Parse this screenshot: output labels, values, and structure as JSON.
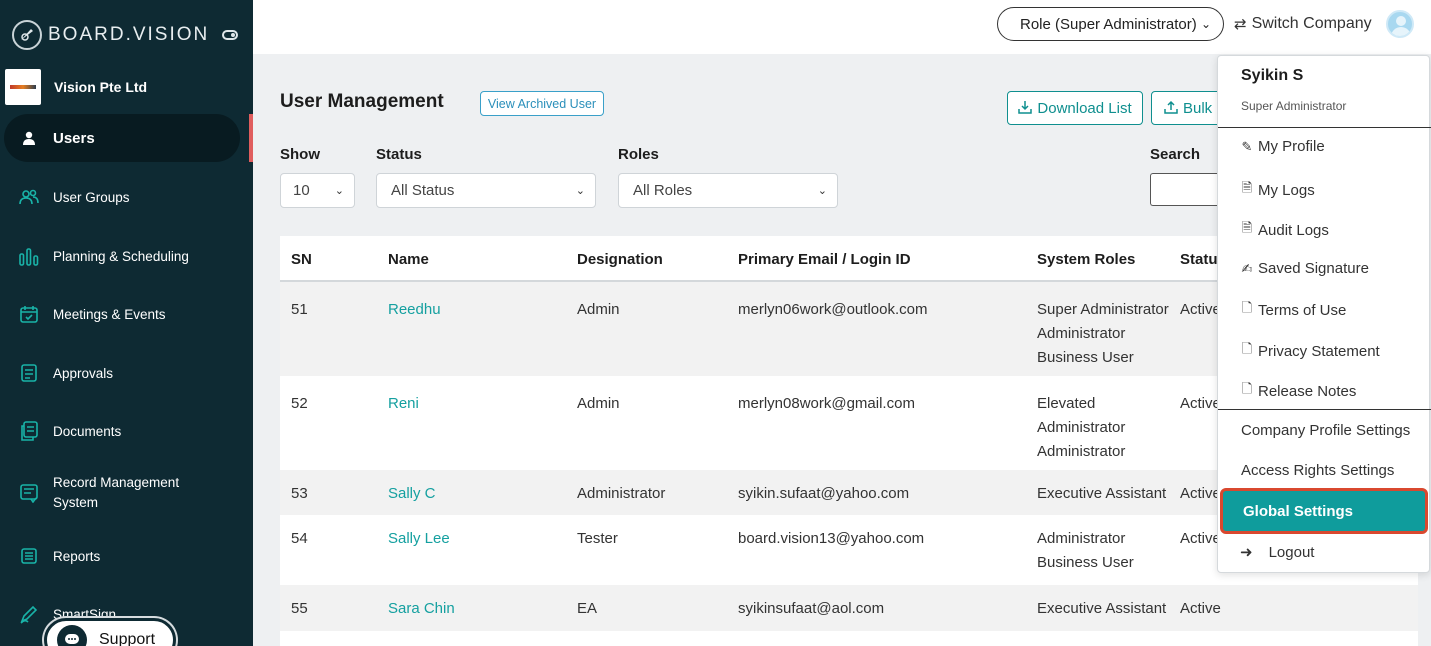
{
  "brand": {
    "name": "BOARD.VISION"
  },
  "company": {
    "name": "Vision Pte Ltd"
  },
  "sidebar": {
    "items": [
      {
        "label": "Users",
        "icon": "user-icon",
        "active": true
      },
      {
        "label": "User Groups",
        "icon": "users-icon"
      },
      {
        "label": "Planning & Scheduling",
        "icon": "bar-chart-icon"
      },
      {
        "label": "Meetings & Events",
        "icon": "calendar-icon"
      },
      {
        "label": "Approvals",
        "icon": "approval-icon"
      },
      {
        "label": "Documents",
        "icon": "documents-icon"
      },
      {
        "label": "Record Management",
        "label2": "System",
        "icon": "record-icon"
      },
      {
        "label": "Reports",
        "icon": "reports-icon"
      },
      {
        "label": "SmartSign",
        "icon": "pen-icon"
      }
    ],
    "support_label": "Support"
  },
  "topbar": {
    "role_label": "Role (Super Administrator)",
    "switch_company": "Switch Company"
  },
  "main": {
    "title": "User Management",
    "view_archived": "View Archived User",
    "download_list": "Download List",
    "bulk": "Bulk",
    "filters": {
      "show_label": "Show",
      "show_value": "10",
      "status_label": "Status",
      "status_value": "All Status",
      "roles_label": "Roles",
      "roles_value": "All Roles",
      "search_label": "Search"
    },
    "table": {
      "headers": [
        "SN",
        "Name",
        "Designation",
        "Primary Email / Login ID",
        "System Roles",
        "Status"
      ],
      "rows": [
        {
          "sn": "51",
          "name": "Reedhu",
          "designation": "Admin",
          "email": "merlyn06work@outlook.com",
          "roles": [
            "Super Administrator",
            "Administrator",
            "Business User"
          ],
          "status": "Active"
        },
        {
          "sn": "52",
          "name": "Reni",
          "designation": "Admin",
          "email": "merlyn08work@gmail.com",
          "roles": [
            "Elevated",
            "Administrator",
            "Administrator"
          ],
          "status": "Active"
        },
        {
          "sn": "53",
          "name": "Sally C",
          "designation": "Administrator",
          "email": "syikin.sufaat@yahoo.com",
          "roles": [
            "Executive Assistant"
          ],
          "status": "Active"
        },
        {
          "sn": "54",
          "name": "Sally Lee",
          "designation": "Tester",
          "email": "board.vision13@yahoo.com",
          "roles": [
            "Administrator",
            "Business User"
          ],
          "status": "Active"
        },
        {
          "sn": "55",
          "name": "Sara Chin",
          "designation": "EA",
          "email": "syikinsufaat@aol.com",
          "roles": [
            "Executive Assistant"
          ],
          "status": "Active"
        }
      ]
    }
  },
  "user_menu": {
    "user_name": "Syikin S",
    "user_role": "Super Administrator",
    "items": [
      {
        "label": "My Profile",
        "icon": "edit-icon"
      },
      {
        "label": "My Logs",
        "icon": "file-text-icon"
      },
      {
        "label": "Audit Logs",
        "icon": "file-text-icon"
      },
      {
        "label": "Saved Signature",
        "icon": "signature-icon"
      },
      {
        "label": "Terms of Use",
        "icon": "file-icon"
      },
      {
        "label": "Privacy Statement",
        "icon": "file-icon"
      },
      {
        "label": "Release Notes",
        "icon": "file-icon"
      }
    ],
    "settings": [
      {
        "label": "Company Profile Settings"
      },
      {
        "label": "Access Rights Settings"
      }
    ],
    "global_settings": "Global Settings",
    "logout": "Logout"
  },
  "colors": {
    "sidebar_bg": "#0e2a33",
    "accent_teal": "#0f9c9c",
    "highlight_border": "#d9482f",
    "link_teal": "#15a0a0"
  }
}
